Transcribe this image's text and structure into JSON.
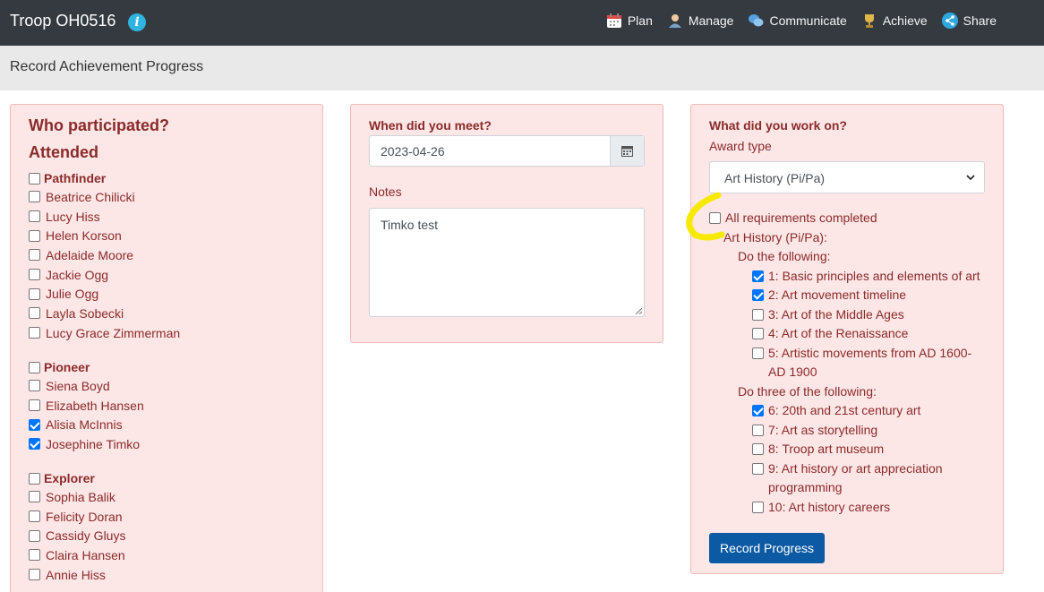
{
  "nav": {
    "brand": "Troop OH0516",
    "info_icon": "i",
    "links": [
      {
        "label": "Plan",
        "icon": "calendar-icon"
      },
      {
        "label": "Manage",
        "icon": "users-icon"
      },
      {
        "label": "Communicate",
        "icon": "chat-icon"
      },
      {
        "label": "Achieve",
        "icon": "trophy-icon"
      },
      {
        "label": "Share",
        "icon": "share-icon"
      }
    ]
  },
  "subbar": {
    "title": "Record Achievement Progress"
  },
  "participants": {
    "heading": "Who participated?",
    "subheading": "Attended",
    "groups": [
      {
        "name": "Pathfinder",
        "checked": false,
        "members": [
          {
            "name": "Beatrice Chilicki",
            "checked": false
          },
          {
            "name": "Lucy Hiss",
            "checked": false
          },
          {
            "name": "Helen Korson",
            "checked": false
          },
          {
            "name": "Adelaide Moore",
            "checked": false
          },
          {
            "name": "Jackie Ogg",
            "checked": false
          },
          {
            "name": "Julie Ogg",
            "checked": false
          },
          {
            "name": "Layla Sobecki",
            "checked": false
          },
          {
            "name": "Lucy Grace Zimmerman",
            "checked": false
          }
        ]
      },
      {
        "name": "Pioneer",
        "checked": false,
        "members": [
          {
            "name": "Siena Boyd",
            "checked": false
          },
          {
            "name": "Elizabeth Hansen",
            "checked": false
          },
          {
            "name": "Alisia McInnis",
            "checked": true
          },
          {
            "name": "Josephine Timko",
            "checked": true
          }
        ]
      },
      {
        "name": "Explorer",
        "checked": false,
        "members": [
          {
            "name": "Sophia Balik",
            "checked": false
          },
          {
            "name": "Felicity Doran",
            "checked": false
          },
          {
            "name": "Cassidy Gluys",
            "checked": false
          },
          {
            "name": "Claira Hansen",
            "checked": false
          },
          {
            "name": "Annie Hiss",
            "checked": false
          }
        ]
      }
    ]
  },
  "meeting": {
    "heading": "When did you meet?",
    "date_value": "2023-04-26",
    "notes_label": "Notes",
    "notes_value": "Timko test"
  },
  "work": {
    "heading": "What did you work on?",
    "award_type_label": "Award type",
    "award_type_value": "Art History (Pi/Pa)",
    "all_completed_label": "All requirements completed",
    "all_completed_checked": false,
    "award_name": "Art History (Pi/Pa):",
    "sections": [
      {
        "label": "Do the following:",
        "items": [
          {
            "label": "1: Basic principles and elements of art",
            "checked": true
          },
          {
            "label": "2: Art movement timeline",
            "checked": true
          },
          {
            "label": "3: Art of the Middle Ages",
            "checked": false
          },
          {
            "label": "4: Art of the Renaissance",
            "checked": false
          },
          {
            "label": "5: Artistic movements from AD 1600-AD 1900",
            "checked": false
          }
        ]
      },
      {
        "label": "Do three of the following:",
        "items": [
          {
            "label": "6: 20th and 21st century art",
            "checked": true
          },
          {
            "label": "7: Art as storytelling",
            "checked": false
          },
          {
            "label": "8: Troop art museum",
            "checked": false
          },
          {
            "label": "9: Art history or art appreciation programming",
            "checked": false
          },
          {
            "label": "10: Art history careers",
            "checked": false
          }
        ]
      }
    ],
    "submit_label": "Record Progress"
  },
  "colors": {
    "panel_bg": "#fde6e6",
    "accent": "#8a2b2b",
    "button": "#0b5aa3",
    "highlight": "#f7ea00"
  }
}
